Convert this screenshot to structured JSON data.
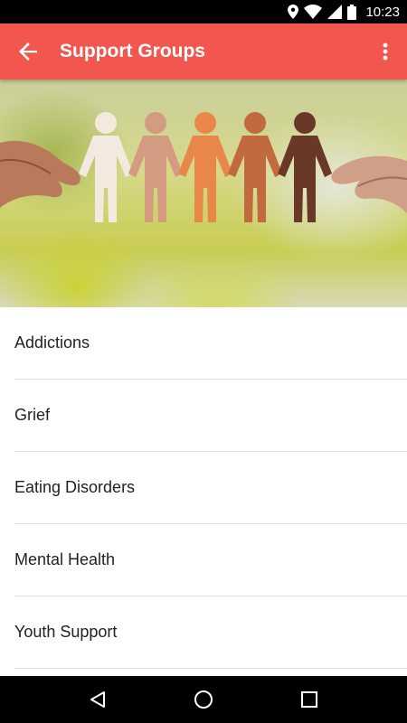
{
  "status_bar": {
    "time": "10:23",
    "icons": [
      "location-icon",
      "wifi-icon",
      "cell-signal-icon",
      "battery-icon"
    ]
  },
  "app_bar": {
    "title": "Support Groups",
    "back_icon": "arrow-back-icon",
    "menu_icon": "more-vert-icon",
    "color": "#f1574f"
  },
  "hero": {
    "image": "paper-people-chain-held-by-hands",
    "figure_colors": [
      "#f3e9de",
      "#d39b82",
      "#e9874a",
      "#c1693f",
      "#6a3826"
    ]
  },
  "groups": [
    {
      "label": "Addictions"
    },
    {
      "label": "Grief"
    },
    {
      "label": "Eating Disorders"
    },
    {
      "label": "Mental Health"
    },
    {
      "label": "Youth Support"
    }
  ],
  "nav_bar": {
    "icons": [
      "back-triangle-icon",
      "home-circle-icon",
      "recents-square-icon"
    ]
  }
}
